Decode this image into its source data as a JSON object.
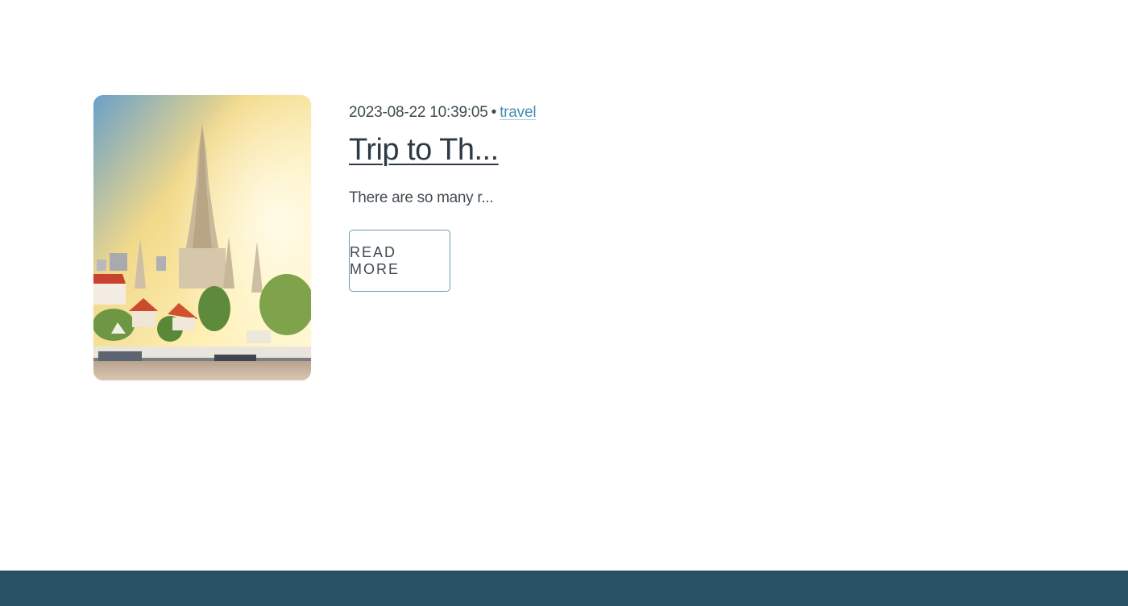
{
  "post": {
    "date": "2023-08-22 10:39:05",
    "separator": "•",
    "category": "travel",
    "title": "Trip to Th...",
    "excerpt": "There are so many r...",
    "read_more_label": "READ MORE",
    "thumbnail_alt": "Temple by the river at sunset"
  },
  "colors": {
    "footer": "#285163",
    "category_link": "#4a8db7",
    "button_border": "#6f98b0"
  }
}
